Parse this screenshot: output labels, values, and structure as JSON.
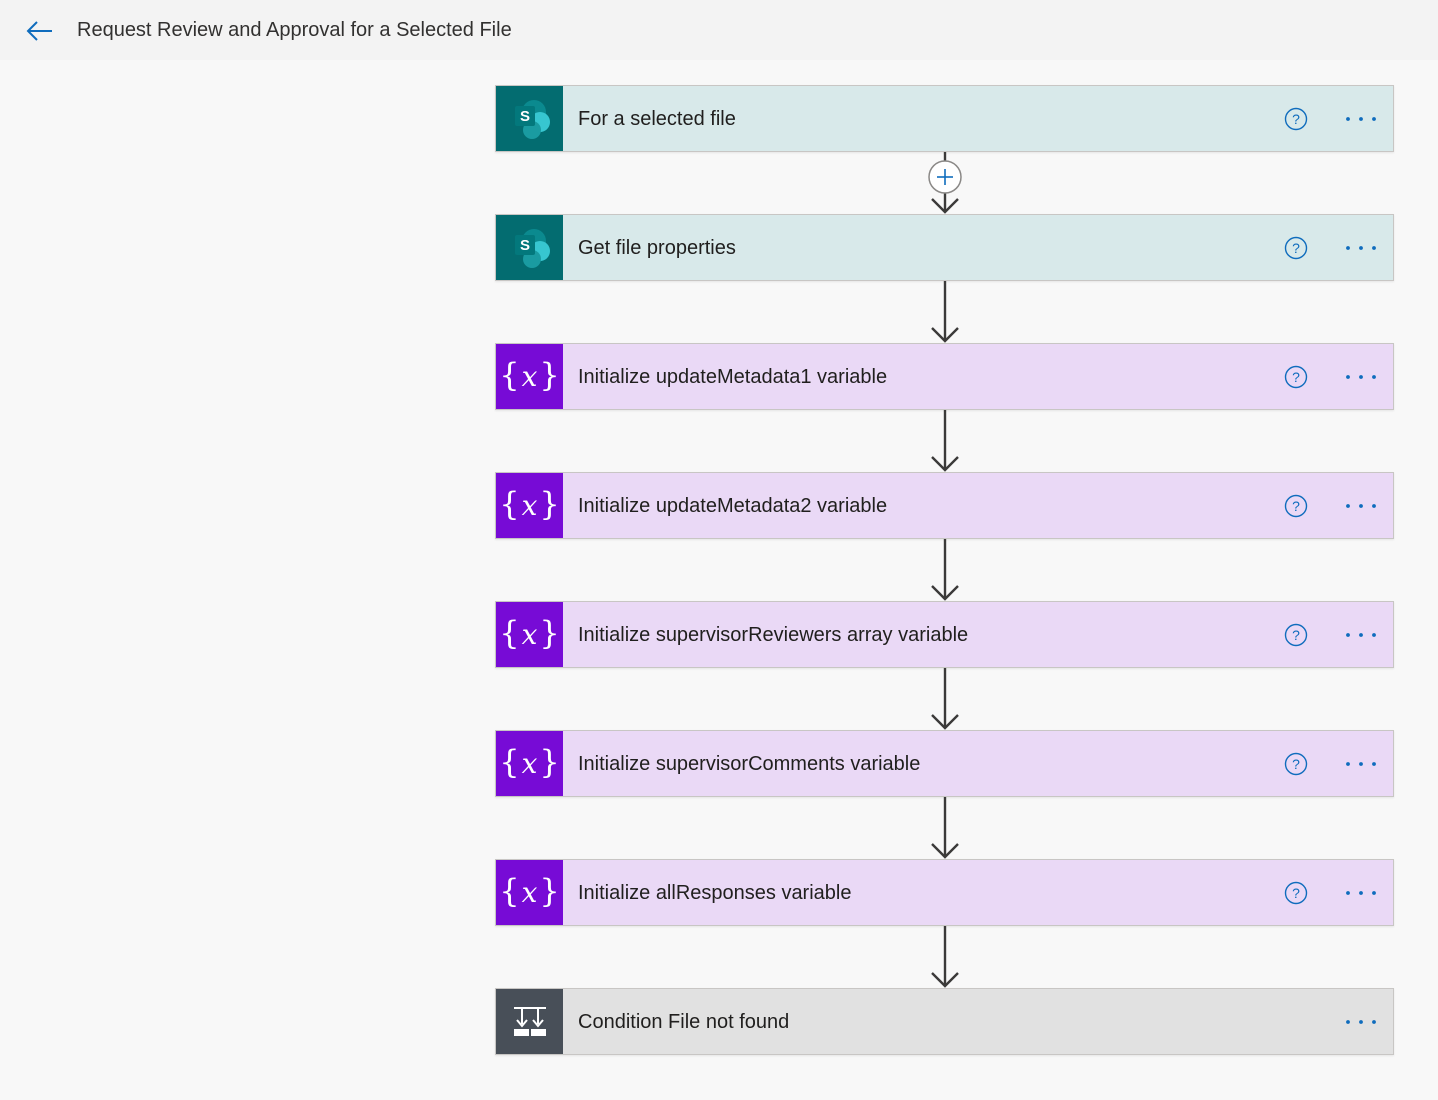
{
  "header": {
    "title": "Request Review and Approval for a Selected File",
    "back_icon": "arrow-left-icon"
  },
  "colors": {
    "sharepoint_card": "#d8e9ea",
    "sharepoint_icon_bg": "#036c70",
    "variable_card": "#ead9f6",
    "variable_icon_bg": "#770bd6",
    "control_card": "#e1e1e1",
    "control_icon_bg": "#484f58",
    "accent": "#0f6cbd"
  },
  "steps": [
    {
      "title": "For a selected file",
      "kind": "sharepoint",
      "icon": "sharepoint-icon",
      "help": true
    },
    {
      "title": "Get file properties",
      "kind": "sharepoint",
      "icon": "sharepoint-icon",
      "help": true
    },
    {
      "title": "Initialize updateMetadata1 variable",
      "kind": "variable",
      "icon": "variable-icon",
      "help": true
    },
    {
      "title": "Initialize updateMetadata2 variable",
      "kind": "variable",
      "icon": "variable-icon",
      "help": true
    },
    {
      "title": "Initialize supervisorReviewers array variable",
      "kind": "variable",
      "icon": "variable-icon",
      "help": true
    },
    {
      "title": "Initialize supervisorComments variable",
      "kind": "variable",
      "icon": "variable-icon",
      "help": true
    },
    {
      "title": "Initialize allResponses variable",
      "kind": "variable",
      "icon": "variable-icon",
      "help": true
    },
    {
      "title": "Condition File not found",
      "kind": "control",
      "icon": "condition-icon",
      "help": false
    }
  ],
  "connectors": [
    {
      "kind": "insert-step",
      "icon": "plus-icon"
    },
    {
      "kind": "arrow",
      "icon": "arrow-down-icon"
    },
    {
      "kind": "arrow",
      "icon": "arrow-down-icon"
    },
    {
      "kind": "arrow",
      "icon": "arrow-down-icon"
    },
    {
      "kind": "arrow",
      "icon": "arrow-down-icon"
    },
    {
      "kind": "arrow",
      "icon": "arrow-down-icon"
    },
    {
      "kind": "arrow",
      "icon": "arrow-down-icon"
    }
  ]
}
